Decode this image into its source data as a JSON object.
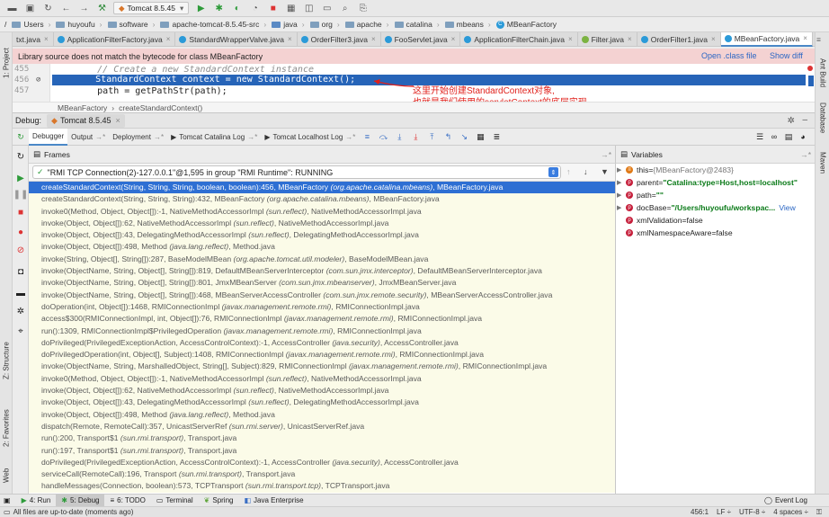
{
  "toolbar": {
    "run_config": "Tomcat 8.5.45"
  },
  "breadcrumb": [
    "/",
    "Users",
    "huyoufu",
    "software",
    "apache-tomcat-8.5.45-src",
    "java",
    "org",
    "apache",
    "catalina",
    "mbeans",
    "MBeanFactory"
  ],
  "editor_tabs": [
    {
      "label": "txt.java",
      "active": false
    },
    {
      "label": "ApplicationFilterFactory.java",
      "active": false
    },
    {
      "label": "StandardWrapperValve.java",
      "active": false
    },
    {
      "label": "OrderFilter3.java",
      "active": false
    },
    {
      "label": "FooServlet.java",
      "active": false
    },
    {
      "label": "ApplicationFilterChain.java",
      "active": false
    },
    {
      "label": "Filter.java",
      "active": false
    },
    {
      "label": "OrderFilter1.java",
      "active": false
    },
    {
      "label": "MBeanFactory.java",
      "active": true
    }
  ],
  "banner": {
    "message": "Library source does not match the bytecode for class MBeanFactory",
    "open_class": "Open .class file",
    "show_diff": "Show diff"
  },
  "code": {
    "lines": [
      {
        "num": "455",
        "text": "        // Create a new StandardContext instance"
      },
      {
        "num": "456",
        "text": "        StandardContext context = new StandardContext();"
      },
      {
        "num": "457",
        "text": "        path = getPathStr(path);"
      }
    ],
    "annotation_line1": "这里开始创建StandardContext对象,",
    "annotation_line2": "也就是我们使用的servletContext的底层实现",
    "editor_breadcrumb_class": "MBeanFactory",
    "editor_breadcrumb_method": "createStandardContext()"
  },
  "debug": {
    "title": "Debug:",
    "session": "Tomcat 8.5.45",
    "tabs": [
      "Debugger",
      "Output",
      "Deployment",
      "Tomcat Catalina Log",
      "Tomcat Localhost Log"
    ],
    "frames_label": "Frames",
    "variables_label": "Variables",
    "thread": "\"RMI TCP Connection(2)-127.0.0.1\"@1,595 in group \"RMI Runtime\": RUNNING",
    "frames": [
      {
        "m": "createStandardContext(String, String, String, boolean, boolean):456, MBeanFactory ",
        "p": "(org.apache.catalina.mbeans)",
        "f": ", MBeanFactory.java"
      },
      {
        "m": "createStandardContext(String, String, String):432, MBeanFactory ",
        "p": "(org.apache.catalina.mbeans)",
        "f": ", MBeanFactory.java"
      },
      {
        "m": "invoke0(Method, Object, Object[]):-1, NativeMethodAccessorImpl ",
        "p": "(sun.reflect)",
        "f": ", NativeMethodAccessorImpl.java"
      },
      {
        "m": "invoke(Object, Object[]):62, NativeMethodAccessorImpl ",
        "p": "(sun.reflect)",
        "f": ", NativeMethodAccessorImpl.java"
      },
      {
        "m": "invoke(Object, Object[]):43, DelegatingMethodAccessorImpl ",
        "p": "(sun.reflect)",
        "f": ", DelegatingMethodAccessorImpl.java"
      },
      {
        "m": "invoke(Object, Object[]):498, Method ",
        "p": "(java.lang.reflect)",
        "f": ", Method.java"
      },
      {
        "m": "invoke(String, Object[], String[]):287, BaseModelMBean ",
        "p": "(org.apache.tomcat.util.modeler)",
        "f": ", BaseModelMBean.java"
      },
      {
        "m": "invoke(ObjectName, String, Object[], String[]):819, DefaultMBeanServerInterceptor ",
        "p": "(com.sun.jmx.interceptor)",
        "f": ", DefaultMBeanServerInterceptor.java"
      },
      {
        "m": "invoke(ObjectName, String, Object[], String[]):801, JmxMBeanServer ",
        "p": "(com.sun.jmx.mbeanserver)",
        "f": ", JmxMBeanServer.java"
      },
      {
        "m": "invoke(ObjectName, String, Object[], String[]):468, MBeanServerAccessController ",
        "p": "(com.sun.jmx.remote.security)",
        "f": ", MBeanServerAccessController.java"
      },
      {
        "m": "doOperation(int, Object[]):1468, RMIConnectionImpl ",
        "p": "(javax.management.remote.rmi)",
        "f": ", RMIConnectionImpl.java"
      },
      {
        "m": "access$300(RMIConnectionImpl, int, Object[]):76, RMIConnectionImpl ",
        "p": "(javax.management.remote.rmi)",
        "f": ", RMIConnectionImpl.java"
      },
      {
        "m": "run():1309, RMIConnectionImpl$PrivilegedOperation ",
        "p": "(javax.management.remote.rmi)",
        "f": ", RMIConnectionImpl.java"
      },
      {
        "m": "doPrivileged(PrivilegedExceptionAction, AccessControlContext):-1, AccessController ",
        "p": "(java.security)",
        "f": ", AccessController.java"
      },
      {
        "m": "doPrivilegedOperation(int, Object[], Subject):1408, RMIConnectionImpl ",
        "p": "(javax.management.remote.rmi)",
        "f": ", RMIConnectionImpl.java"
      },
      {
        "m": "invoke(ObjectName, String, MarshalledObject, String[], Subject):829, RMIConnectionImpl ",
        "p": "(javax.management.remote.rmi)",
        "f": ", RMIConnectionImpl.java"
      },
      {
        "m": "invoke0(Method, Object, Object[]):-1, NativeMethodAccessorImpl ",
        "p": "(sun.reflect)",
        "f": ", NativeMethodAccessorImpl.java"
      },
      {
        "m": "invoke(Object, Object[]):62, NativeMethodAccessorImpl ",
        "p": "(sun.reflect)",
        "f": ", NativeMethodAccessorImpl.java"
      },
      {
        "m": "invoke(Object, Object[]):43, DelegatingMethodAccessorImpl ",
        "p": "(sun.reflect)",
        "f": ", DelegatingMethodAccessorImpl.java"
      },
      {
        "m": "invoke(Object, Object[]):498, Method ",
        "p": "(java.lang.reflect)",
        "f": ", Method.java"
      },
      {
        "m": "dispatch(Remote, RemoteCall):357, UnicastServerRef ",
        "p": "(sun.rmi.server)",
        "f": ", UnicastServerRef.java"
      },
      {
        "m": "run():200, Transport$1 ",
        "p": "(sun.rmi.transport)",
        "f": ", Transport.java"
      },
      {
        "m": "run():197, Transport$1 ",
        "p": "(sun.rmi.transport)",
        "f": ", Transport.java"
      },
      {
        "m": "doPrivileged(PrivilegedExceptionAction, AccessControlContext):-1, AccessController ",
        "p": "(java.security)",
        "f": ", AccessController.java"
      },
      {
        "m": "serviceCall(RemoteCall):196, Transport ",
        "p": "(sun.rmi.transport)",
        "f": ", Transport.java"
      },
      {
        "m": "handleMessages(Connection, boolean):573, TCPTransport ",
        "p": "(sun.rmi.transport.tcp)",
        "f": ", TCPTransport.java"
      }
    ],
    "variables": [
      {
        "name": "this",
        "eq": " = ",
        "value": "{MBeanFactory@2483}",
        "style": "gray",
        "icon": "red",
        "expand": true
      },
      {
        "name": "parent",
        "eq": " = ",
        "value": "\"Catalina:type=Host,host=localhost\"",
        "style": "str",
        "icon": "red",
        "expand": true
      },
      {
        "name": "path",
        "eq": " = ",
        "value": "\"\"",
        "style": "str",
        "icon": "red",
        "expand": true
      },
      {
        "name": "docBase",
        "eq": " = ",
        "value": "\"/Users/huyoufu/workspac...",
        "style": "str",
        "icon": "red",
        "expand": true,
        "link": "View"
      },
      {
        "name": "xmlValidation",
        "eq": " = ",
        "value": "false",
        "style": "plain",
        "icon": "red",
        "expand": false
      },
      {
        "name": "xmlNamespaceAware",
        "eq": " = ",
        "value": "false",
        "style": "plain",
        "icon": "red",
        "expand": false
      }
    ]
  },
  "left_stripe": [
    "1: Project",
    "Z: Structure",
    "2: Favorites",
    "Web"
  ],
  "right_stripe": [
    "Ant Build",
    "Database",
    "Maven"
  ],
  "bottom_tools": [
    {
      "label": "4: Run",
      "active": false
    },
    {
      "label": "5: Debug",
      "active": true
    },
    {
      "label": "6: TODO",
      "active": false
    },
    {
      "label": "Terminal",
      "active": false
    },
    {
      "label": "Spring",
      "active": false
    },
    {
      "label": "Java Enterprise",
      "active": false
    }
  ],
  "event_log": "Event Log",
  "status": {
    "message": "All files are up-to-date (moments ago)",
    "position": "456:1",
    "line_sep": "LF ÷",
    "encoding": "UTF-8 ÷",
    "indent": "4 spaces ÷"
  }
}
